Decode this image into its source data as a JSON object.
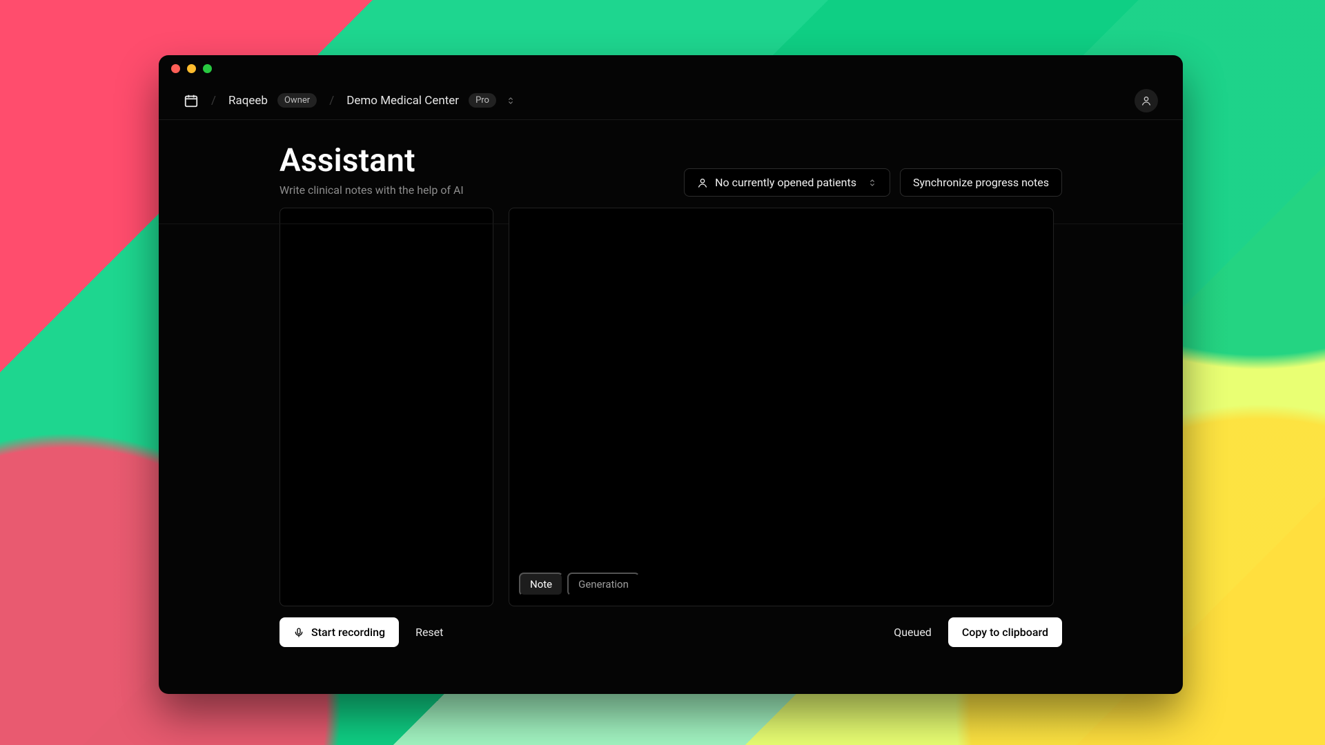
{
  "breadcrumb": {
    "user": "Raqeeb",
    "user_badge": "Owner",
    "org": "Demo Medical Center",
    "org_badge": "Pro"
  },
  "header": {
    "title": "Assistant",
    "subtitle": "Write clinical notes with the help of AI"
  },
  "selectors": {
    "patients_label": "No currently opened patients",
    "sync_label": "Synchronize progress notes"
  },
  "tabs": {
    "note": "Note",
    "generation": "Generation"
  },
  "controls": {
    "start_recording": "Start recording",
    "reset": "Reset",
    "queued": "Queued",
    "copy": "Copy to clipboard"
  }
}
